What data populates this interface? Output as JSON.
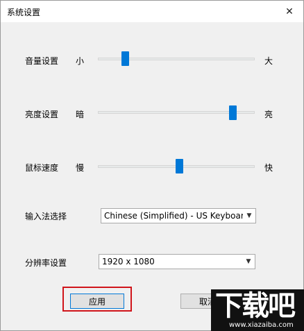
{
  "window": {
    "title": "系统设置",
    "close_glyph": "✕"
  },
  "sliders": [
    {
      "label": "音量设置",
      "min_label": "小",
      "max_label": "大",
      "value": 0.16
    },
    {
      "label": "亮度设置",
      "min_label": "暗",
      "max_label": "亮",
      "value": 0.88
    },
    {
      "label": "鼠标速度",
      "min_label": "慢",
      "max_label": "快",
      "value": 0.52
    }
  ],
  "input_method": {
    "label": "输入法选择",
    "selected": "Chinese (Simplified) - US Keyboard"
  },
  "resolution": {
    "label": "分辨率设置",
    "selected": "1920 x 1080"
  },
  "buttons": {
    "apply": "应用",
    "cancel": "取消"
  },
  "watermark": {
    "text": "下载吧",
    "url": "www.xiazaiba.com"
  },
  "colors": {
    "accent": "#0078d7",
    "highlight": "#d0141a"
  }
}
